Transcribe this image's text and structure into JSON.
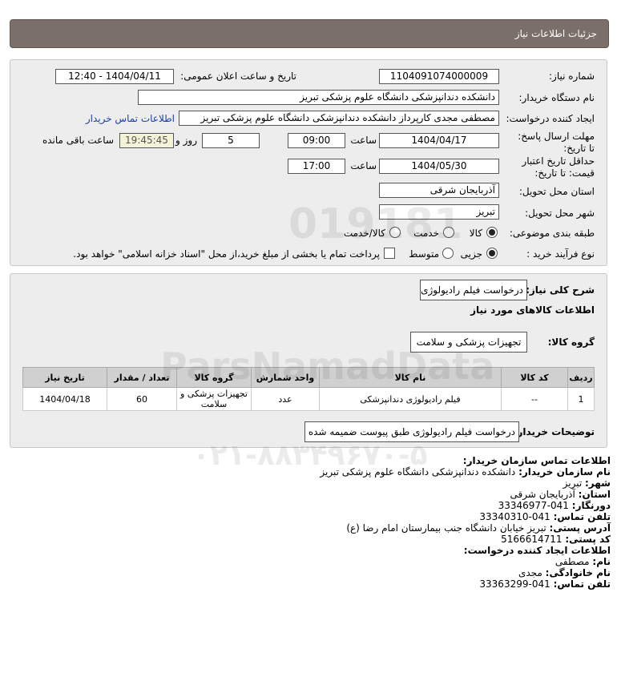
{
  "header": {
    "title": "جزئیات اطلاعات نیاز"
  },
  "form": {
    "need_number_label": "شماره نیاز:",
    "need_number": "1104091074000009",
    "announce_label": "تاریخ و ساعت اعلان عمومی:",
    "announce_value": "1404/04/11 - 12:40",
    "buyer_org_label": "نام دستگاه خریدار:",
    "buyer_org": "دانشکده دندانپزشکی دانشگاه علوم پزشکی تبریز",
    "creator_label": "ایجاد کننده درخواست:",
    "creator": "مصطفی مجدی کارپرداز دانشکده دندانپزشکی دانشگاه علوم پزشکی تبریز",
    "contact_link": "اطلاعات تماس خریدار",
    "deadline_label": "مهلت ارسال پاسخ: تا تاریخ:",
    "deadline_date": "1404/04/17",
    "time_label": "ساعت",
    "deadline_time": "09:00",
    "days": "5",
    "days_label": "روز و",
    "remaining_time": "19:45:45",
    "remaining_label": "ساعت باقی مانده",
    "validity_label": "حداقل تاریخ اعتبار قیمت: تا تاریخ:",
    "validity_date": "1404/05/30",
    "validity_time": "17:00",
    "province_label": "استان محل تحویل:",
    "province": "آذربایجان شرقی",
    "city_label": "شهر محل تحویل:",
    "city": "تبریز",
    "category_label": "طبقه بندی موضوعی:",
    "category_options": [
      "کالا",
      "خدمت",
      "کالا/خدمت"
    ],
    "process_label": "نوع فرآیند خرید :",
    "process_options": [
      "جزیی",
      "متوسط"
    ],
    "payment_note": "پرداخت تمام یا بخشی از مبلغ خرید،از محل \"اسناد خزانه اسلامی\" خواهد بود."
  },
  "summary": {
    "desc_label": "شرح کلی نیاز:",
    "desc": "درخواست فیلم رادیولوژی",
    "goods_info_title": "اطلاعات کالاهای مورد نیاز",
    "group_label": "گروه کالا:",
    "group": "تجهیزات پزشکی و سلامت",
    "table": {
      "headers": [
        "ردیف",
        "کد کالا",
        "نام کالا",
        "واحد شمارش",
        "گروه کالا",
        "تعداد / مقدار",
        "تاریخ نیاز"
      ],
      "rows": [
        [
          "1",
          "--",
          "فیلم رادیولوژی دندانپزشکی",
          "عدد",
          "تجهیزات پزشکی و سلامت",
          "60",
          "1404/04/18"
        ]
      ]
    },
    "buyer_notes_label": "توضیحات خریدار:",
    "buyer_notes": "درخواست فیلم رادیولوژی طبق پیوست ضمیمه شده"
  },
  "contact": {
    "title": "اطلاعات تماس سازمان خریدار:",
    "org_label": "نام سازمان خریدار:",
    "org": "دانشکده دندانپزشکی دانشگاه علوم پزشکی تبریز",
    "city_label": "شهر:",
    "city": "تبریز",
    "province_label": "استان:",
    "province": "آذربایجان شرقی",
    "fax_label": "دورنگار:",
    "fax": "041-33346977",
    "phone_label": "تلفن تماس:",
    "phone": "041-33340310",
    "address_label": "آدرس پستی:",
    "address": "تبریز خیابان دانشگاه جنب بیمارستان امام رضا (ع)",
    "postal_label": "کد پستی:",
    "postal": "5166614711",
    "creator_title": "اطلاعات ایجاد کننده درخواست:",
    "first_name_label": "نام:",
    "first_name": "مصطفی",
    "last_name_label": "نام خانوادگی:",
    "last_name": "مجدی",
    "creator_phone_label": "تلفن تماس:",
    "creator_phone": "041-33363299"
  },
  "watermark": {
    "brand": "ParsNamadData",
    "number": "۰۲۱-۸۸۳۴۹۶۷۰-۵",
    "digits": "019181"
  }
}
